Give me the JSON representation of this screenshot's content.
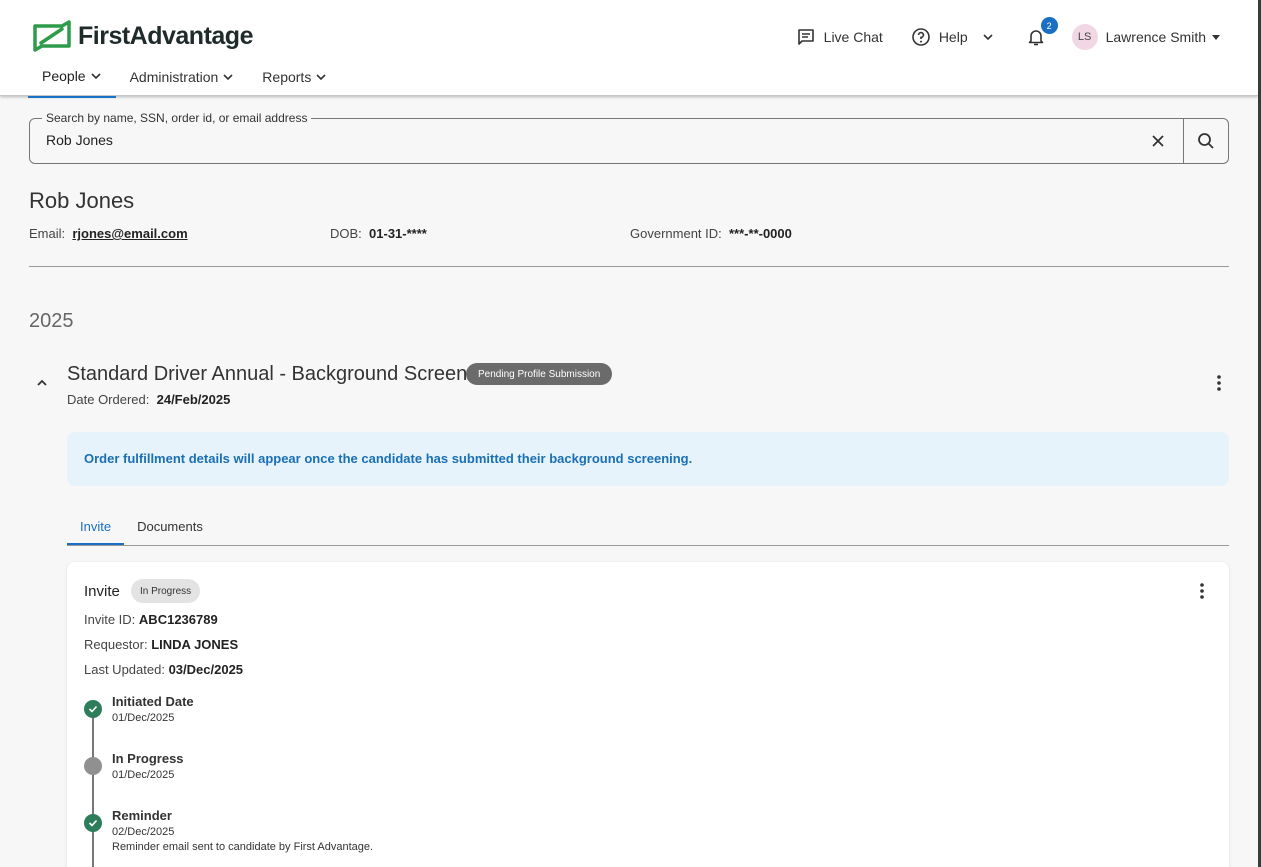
{
  "brand": {
    "name": "FirstAdvantage",
    "accent": "#1a72c7",
    "logo_color": "#2d9b4a"
  },
  "nav": [
    {
      "label": "People",
      "active": true
    },
    {
      "label": "Administration",
      "active": false
    },
    {
      "label": "Reports",
      "active": false
    }
  ],
  "header": {
    "live_chat": "Live Chat",
    "help": "Help",
    "notification_count": "2",
    "user_initials": "LS",
    "user_name": "Lawrence Smith"
  },
  "search": {
    "label": "Search by name, SSN, order id, or email address",
    "value": "Rob Jones"
  },
  "person": {
    "name": "Rob Jones",
    "email_label": "Email:",
    "email": "rjones@email.com",
    "dob_label": "DOB:",
    "dob": "01-31-****",
    "gov_label": "Government ID:",
    "gov_id": "***-**-0000"
  },
  "year": "2025",
  "order": {
    "title": "Standard Driver Annual - Background Screen",
    "status": "Pending Profile Submission",
    "date_label": "Date Ordered:",
    "date": "24/Feb/2025",
    "banner": "Order fulfillment details will appear once the candidate has submitted their background screening."
  },
  "tabs": [
    {
      "label": "Invite",
      "active": true
    },
    {
      "label": "Documents",
      "active": false
    }
  ],
  "invite": {
    "title": "Invite",
    "status": "In Progress",
    "id_label": "Invite ID:",
    "id": "ABC1236789",
    "requestor_label": "Requestor:",
    "requestor": "LINDA JONES",
    "updated_label": "Last Updated:",
    "updated": "03/Dec/2025",
    "timeline": [
      {
        "title": "Initiated Date",
        "date": "01/Dec/2025",
        "note": "",
        "state": "done"
      },
      {
        "title": "In Progress",
        "date": "01/Dec/2025",
        "note": "",
        "state": "pending"
      },
      {
        "title": "Reminder",
        "date": "02/Dec/2025",
        "note": "Reminder email sent to candidate by First Advantage.",
        "state": "done"
      }
    ]
  }
}
